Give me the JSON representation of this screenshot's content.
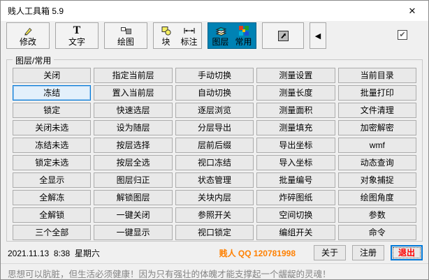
{
  "window": {
    "title": "贱人工具箱 5.9"
  },
  "icons": {
    "close": "✕",
    "text_tool": "T",
    "collapse": "◀",
    "checkbox_check": "✔",
    "pencil": "pencil-icon",
    "draw": "shapes-icon",
    "block": "block-circle-icon",
    "dimension": "dimension-arrow-icon",
    "layers": "layers-stack-icon",
    "common": "color-grid-icon",
    "shortcut": "arrow-up-right-icon"
  },
  "toolbar": {
    "modify_label": "修改",
    "text_label": "文字",
    "draw_label": "绘图",
    "block_label": "块",
    "dimension_label": "标注",
    "layer_label": "图层",
    "common_label": "常用",
    "active_tab_bg": "#0082B4",
    "checkbox_checked": true
  },
  "groupbox": {
    "label": "图层/常用"
  },
  "grid": {
    "columns": 5,
    "cells": [
      {
        "label": "关闭"
      },
      {
        "label": "指定当前层"
      },
      {
        "label": "手动切换"
      },
      {
        "label": "测量设置"
      },
      {
        "label": "当前目录"
      },
      {
        "label": "冻结",
        "state": "focused"
      },
      {
        "label": "置入当前层"
      },
      {
        "label": "自动切换"
      },
      {
        "label": "测量长度"
      },
      {
        "label": "批量打印"
      },
      {
        "label": "锁定"
      },
      {
        "label": "快速选层"
      },
      {
        "label": "逐层浏览"
      },
      {
        "label": "测量面积"
      },
      {
        "label": "文件清理"
      },
      {
        "label": "关闭未选"
      },
      {
        "label": "设为随层"
      },
      {
        "label": "分层导出"
      },
      {
        "label": "测量填充"
      },
      {
        "label": "加密解密"
      },
      {
        "label": "冻结未选"
      },
      {
        "label": "按层选择"
      },
      {
        "label": "层前后缀"
      },
      {
        "label": "导出坐标"
      },
      {
        "label": "wmf"
      },
      {
        "label": "锁定未选"
      },
      {
        "label": "按层全选"
      },
      {
        "label": "视口冻结"
      },
      {
        "label": "导入坐标"
      },
      {
        "label": "动态查询"
      },
      {
        "label": "全显示"
      },
      {
        "label": "图层归正"
      },
      {
        "label": "状态管理"
      },
      {
        "label": "批量编号"
      },
      {
        "label": "对象捕捉"
      },
      {
        "label": "全解冻"
      },
      {
        "label": "解锁图层"
      },
      {
        "label": "关块内层"
      },
      {
        "label": "炸碎图纸"
      },
      {
        "label": "绘图角度"
      },
      {
        "label": "全解锁"
      },
      {
        "label": "一键关闭"
      },
      {
        "label": "参照开关"
      },
      {
        "label": "空间切换"
      },
      {
        "label": "参数"
      },
      {
        "label": "三个全部"
      },
      {
        "label": "一键显示"
      },
      {
        "label": "视口锁定"
      },
      {
        "label": "编组开关"
      },
      {
        "label": "命令"
      }
    ]
  },
  "statusbar": {
    "date": "2021.11.13  8:38  星期六",
    "contact": "贱人 QQ 120781998",
    "contact_color": "#FF8000",
    "about_label": "关于",
    "register_label": "注册",
    "exit_label": "退出",
    "exit_color": "#FF0000"
  },
  "footer": {
    "motto": "思想可以肮脏，但生活必须健康！因为只有强壮的体魄才能支撑起一个龌龊的灵魂！",
    "color": "#858585"
  }
}
